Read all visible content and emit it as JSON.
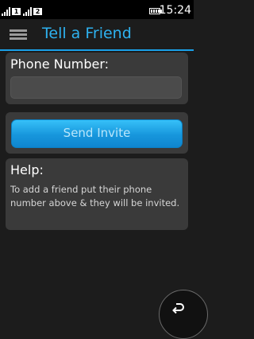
{
  "status_bar": {
    "sim1_label": "1",
    "sim2_label": "2",
    "time": "15:24",
    "icons": [
      "signal-icon",
      "battery-icon"
    ]
  },
  "header": {
    "title": "Tell a Friend",
    "menu_icon": "menu-icon",
    "accent_color": "#2eb2f0"
  },
  "form": {
    "phone_label": "Phone Number:",
    "phone_value": "",
    "phone_placeholder": "",
    "send_button_label": "Send Invite",
    "button_color": "#1aa0e8"
  },
  "help": {
    "title": "Help:",
    "text": "To add a friend put their phone number above & they will be invited."
  },
  "nav": {
    "back_icon": "back-arrow-icon"
  }
}
